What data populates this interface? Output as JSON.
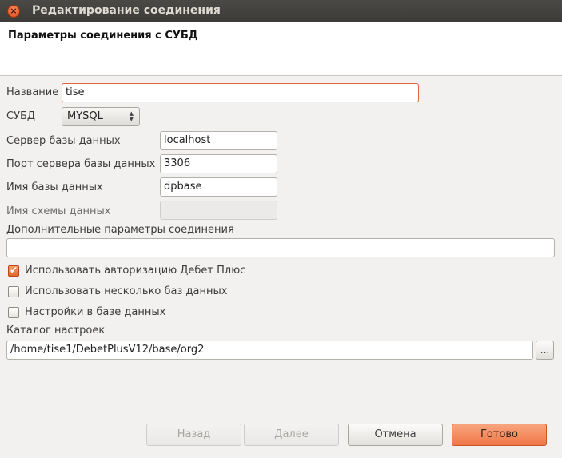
{
  "window": {
    "title": "Редактирование соединения"
  },
  "page": {
    "title": "Параметры соединения с СУБД"
  },
  "form": {
    "name_label": "Название",
    "name_value": "tise",
    "dbms_label": "СУБД",
    "dbms_value": "MYSQL",
    "server_label": "Сервер базы данных",
    "server_value": "localhost",
    "port_label": "Порт сервера базы данных",
    "port_value": "3306",
    "dbname_label": "Имя базы данных",
    "dbname_value": "dpbase",
    "schema_label": "Имя схемы данных",
    "schema_value": "",
    "extra_label": "Дополнительные параметры соединения",
    "extra_value": "",
    "use_auth_label": "Использовать авторизацию Дебет Плюс",
    "use_auth_checked": true,
    "multi_db_label": "Использовать несколько баз данных",
    "multi_db_checked": false,
    "settings_db_label": "Настройки в базе данных",
    "settings_db_checked": false,
    "catalog_label": "Каталог настроек",
    "catalog_value": "/home/tise1/DebetPlusV12/base/org2",
    "browse_label": "..."
  },
  "buttons": {
    "back": "Назад",
    "next": "Далее",
    "cancel": "Отмена",
    "finish": "Готово"
  },
  "colors": {
    "accent": "#f07746",
    "titlebar": "#3c3b37",
    "focus_border": "#e0633b"
  }
}
